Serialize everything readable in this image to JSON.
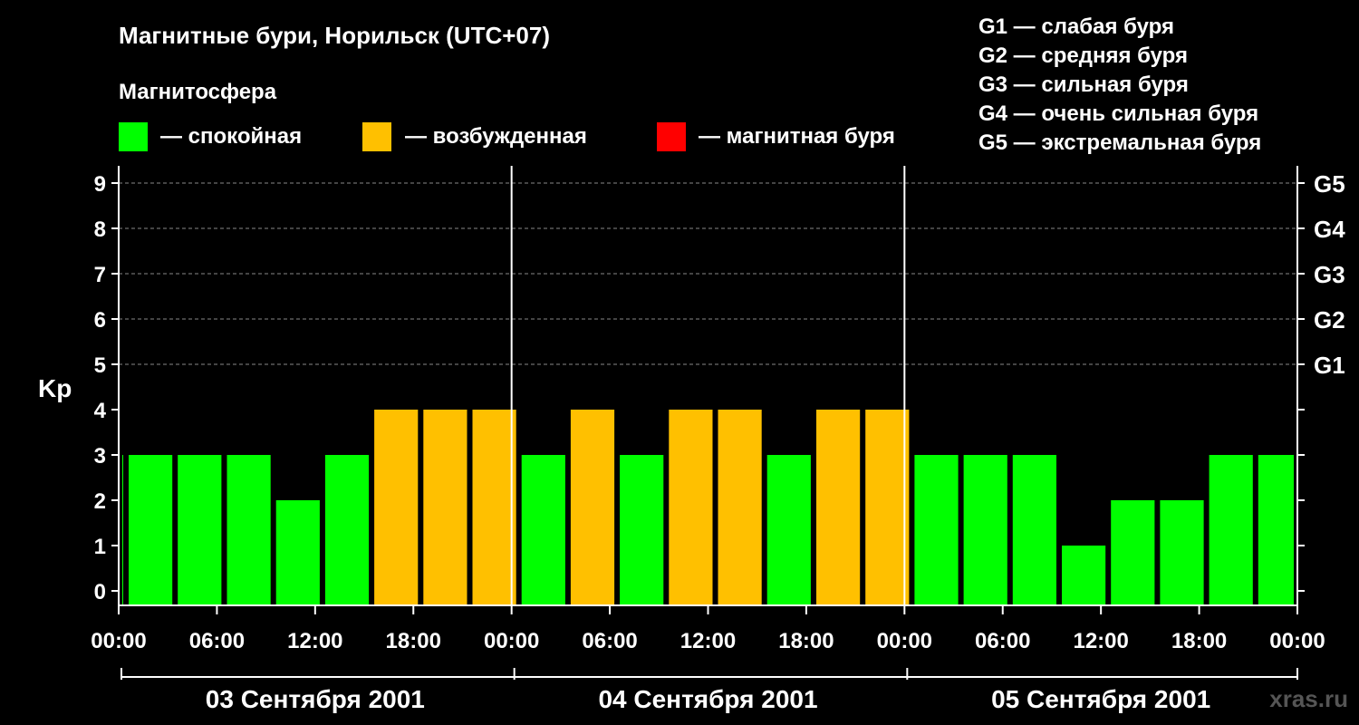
{
  "title": "Магнитные бури, Норильск (UTC+07)",
  "legend": {
    "heading": "Магнитосфера",
    "items": [
      {
        "label": "— спокойная",
        "color": "#00ff00"
      },
      {
        "label": "— возбужденная",
        "color": "#ffc000"
      },
      {
        "label": "— магнитная буря",
        "color": "#ff0000"
      }
    ]
  },
  "g_scale": [
    "G1 — слабая буря",
    "G2 — средняя буря",
    "G3 — сильная буря",
    "G4 — очень сильная буря",
    "G5 — экстремальная буря"
  ],
  "watermark": "xras.ru",
  "chart_data": {
    "type": "bar",
    "ylabel": "Kp",
    "ylim": [
      0,
      9
    ],
    "yticks": [
      0,
      1,
      2,
      3,
      4,
      5,
      6,
      7,
      8,
      9
    ],
    "right_labels": [
      {
        "value": 5,
        "label": "G1"
      },
      {
        "value": 6,
        "label": "G2"
      },
      {
        "value": 7,
        "label": "G3"
      },
      {
        "value": 8,
        "label": "G4"
      },
      {
        "value": 9,
        "label": "G5"
      }
    ],
    "grid": "horizontal dashed at 5–9",
    "x_tick_labels": [
      "00:00",
      "06:00",
      "12:00",
      "18:00",
      "00:00",
      "06:00",
      "12:00",
      "18:00",
      "00:00",
      "06:00",
      "12:00",
      "18:00",
      "00:00"
    ],
    "days": [
      "03 Сентября 2001",
      "04 Сентября 2001",
      "05 Сентября 2001"
    ],
    "series": [
      {
        "values": [
          3,
          3,
          3,
          3,
          2,
          3,
          4,
          4,
          4,
          3,
          4,
          3,
          4,
          4,
          3,
          4,
          4,
          3,
          3,
          3,
          1,
          2,
          2,
          3,
          3
        ],
        "levels": [
          "quiet",
          "quiet",
          "quiet",
          "quiet",
          "quiet",
          "quiet",
          "active",
          "active",
          "active",
          "quiet",
          "active",
          "quiet",
          "active",
          "active",
          "quiet",
          "active",
          "active",
          "quiet",
          "quiet",
          "quiet",
          "quiet",
          "quiet",
          "quiet",
          "quiet",
          "quiet"
        ]
      }
    ],
    "level_colors": {
      "quiet": "#00ff00",
      "active": "#ffc000",
      "storm": "#ff0000"
    }
  }
}
